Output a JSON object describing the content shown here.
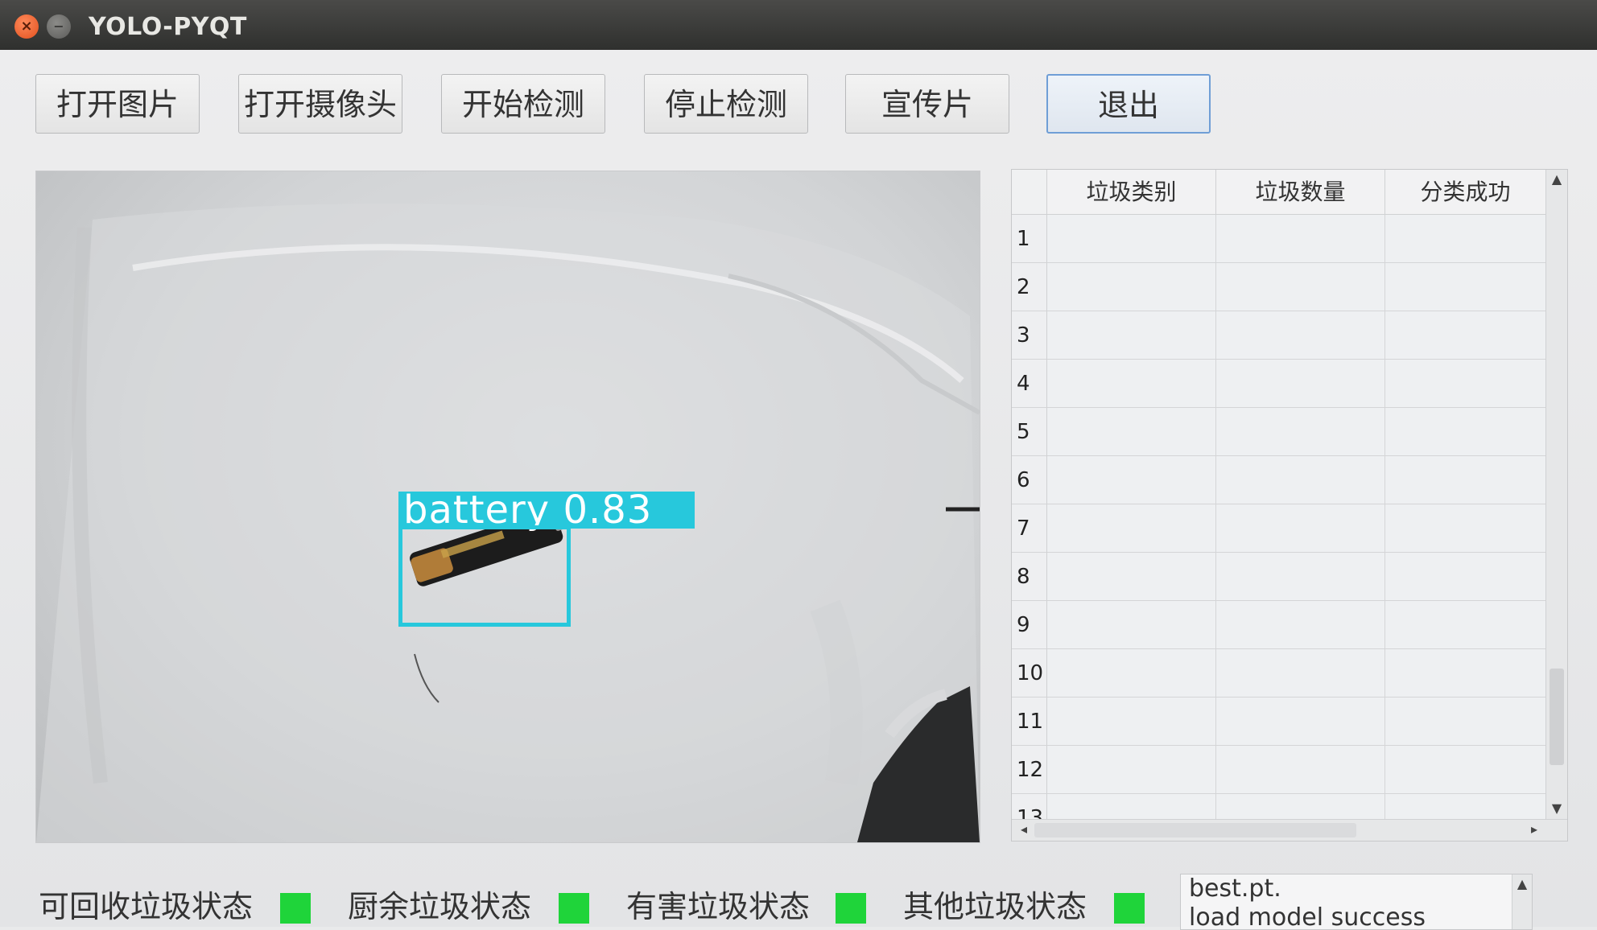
{
  "window": {
    "title": "YOLO-PYQT"
  },
  "toolbar": {
    "buttons": [
      "打开图片",
      "打开摄像头",
      "开始检测",
      "停止检测",
      "宣传片",
      "退出"
    ]
  },
  "detection": {
    "label": "battery 0.83",
    "class": "battery",
    "confidence": 0.83,
    "color": "#27c8dc"
  },
  "table": {
    "headers": [
      "垃圾类别",
      "垃圾数量",
      "分类成功"
    ],
    "rows": [
      "1",
      "2",
      "3",
      "4",
      "5",
      "6",
      "7",
      "8",
      "9",
      "10",
      "11",
      "12",
      "13"
    ]
  },
  "status": [
    {
      "label": "可回收垃圾状态",
      "color": "#1fd43a"
    },
    {
      "label": "厨余垃圾状态",
      "color": "#1fd43a"
    },
    {
      "label": "有害垃圾状态",
      "color": "#1fd43a"
    },
    {
      "label": "其他垃圾状态",
      "color": "#1fd43a"
    }
  ],
  "log": {
    "lines": [
      "best.pt.",
      "load model success"
    ]
  }
}
